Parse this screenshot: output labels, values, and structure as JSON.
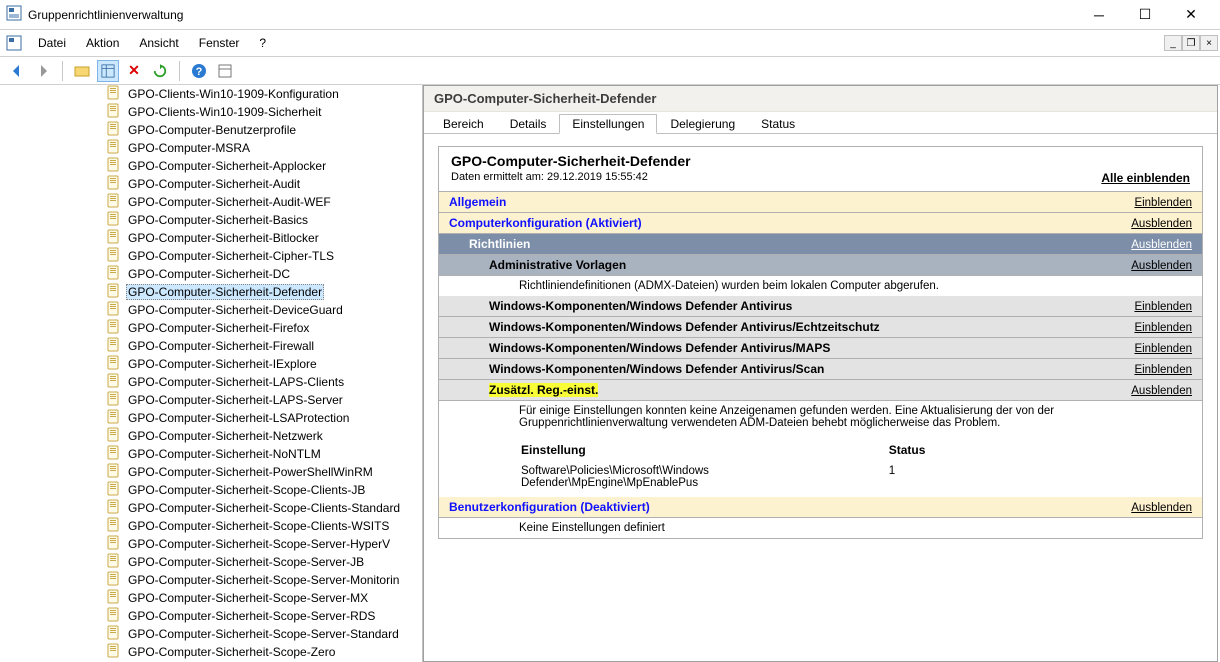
{
  "window": {
    "title": "Gruppenrichtlinienverwaltung"
  },
  "menu": {
    "items": [
      "Datei",
      "Aktion",
      "Ansicht",
      "Fenster",
      "?"
    ]
  },
  "tree": {
    "items": [
      "GPO-Clients-Win10-1909-Konfiguration",
      "GPO-Clients-Win10-1909-Sicherheit",
      "GPO-Computer-Benutzerprofile",
      "GPO-Computer-MSRA",
      "GPO-Computer-Sicherheit-Applocker",
      "GPO-Computer-Sicherheit-Audit",
      "GPO-Computer-Sicherheit-Audit-WEF",
      "GPO-Computer-Sicherheit-Basics",
      "GPO-Computer-Sicherheit-Bitlocker",
      "GPO-Computer-Sicherheit-Cipher-TLS",
      "GPO-Computer-Sicherheit-DC",
      "GPO-Computer-Sicherheit-Defender",
      "GPO-Computer-Sicherheit-DeviceGuard",
      "GPO-Computer-Sicherheit-Firefox",
      "GPO-Computer-Sicherheit-Firewall",
      "GPO-Computer-Sicherheit-IExplore",
      "GPO-Computer-Sicherheit-LAPS-Clients",
      "GPO-Computer-Sicherheit-LAPS-Server",
      "GPO-Computer-Sicherheit-LSAProtection",
      "GPO-Computer-Sicherheit-Netzwerk",
      "GPO-Computer-Sicherheit-NoNTLM",
      "GPO-Computer-Sicherheit-PowerShellWinRM",
      "GPO-Computer-Sicherheit-Scope-Clients-JB",
      "GPO-Computer-Sicherheit-Scope-Clients-Standard",
      "GPO-Computer-Sicherheit-Scope-Clients-WSITS",
      "GPO-Computer-Sicherheit-Scope-Server-HyperV",
      "GPO-Computer-Sicherheit-Scope-Server-JB",
      "GPO-Computer-Sicherheit-Scope-Server-Monitorin",
      "GPO-Computer-Sicherheit-Scope-Server-MX",
      "GPO-Computer-Sicherheit-Scope-Server-RDS",
      "GPO-Computer-Sicherheit-Scope-Server-Standard",
      "GPO-Computer-Sicherheit-Scope-Zero"
    ],
    "selected_index": 11
  },
  "content": {
    "header_title": "GPO-Computer-Sicherheit-Defender",
    "tabs": [
      "Bereich",
      "Details",
      "Einstellungen",
      "Delegierung",
      "Status"
    ],
    "active_tab_index": 2,
    "report": {
      "title": "GPO-Computer-Sicherheit-Defender",
      "meta": "Daten ermittelt am: 29.12.2019 15:55:42",
      "expand_all": "Alle einblenden",
      "sections": {
        "general": {
          "label": "Allgemein",
          "action": "Einblenden"
        },
        "computer_cfg": {
          "label": "Computerkonfiguration (Aktiviert)",
          "action": "Ausblenden"
        },
        "policies": {
          "label": "Richtlinien",
          "action": "Ausblenden"
        },
        "admin_templates": {
          "label": "Administrative Vorlagen",
          "action": "Ausblenden"
        },
        "admx_note": "Richtliniendefinitionen (ADMX-Dateien) wurden beim lokalen Computer abgerufen.",
        "cats": [
          {
            "label": "Windows-Komponenten/Windows Defender Antivirus",
            "action": "Einblenden"
          },
          {
            "label": "Windows-Komponenten/Windows Defender Antivirus/Echtzeitschutz",
            "action": "Einblenden"
          },
          {
            "label": "Windows-Komponenten/Windows Defender Antivirus/MAPS",
            "action": "Einblenden"
          },
          {
            "label": "Windows-Komponenten/Windows Defender Antivirus/Scan",
            "action": "Einblenden"
          }
        ],
        "extra_reg": {
          "label": "Zusätzl. Reg.-einst.",
          "action": "Ausblenden"
        },
        "extra_reg_note": "Für einige Einstellungen konnten keine Anzeigenamen gefunden werden. Eine Aktualisierung der von der Gruppenrichtlinienverwaltung verwendeten ADM-Dateien behebt möglicherweise das Problem.",
        "table": {
          "col_setting": "Einstellung",
          "col_status": "Status",
          "row_setting": "Software\\Policies\\Microsoft\\Windows Defender\\MpEngine\\MpEnablePus",
          "row_status": "1"
        },
        "user_cfg": {
          "label": "Benutzerkonfiguration (Deaktiviert)",
          "action": "Ausblenden"
        },
        "user_cfg_note": "Keine Einstellungen definiert"
      }
    }
  }
}
